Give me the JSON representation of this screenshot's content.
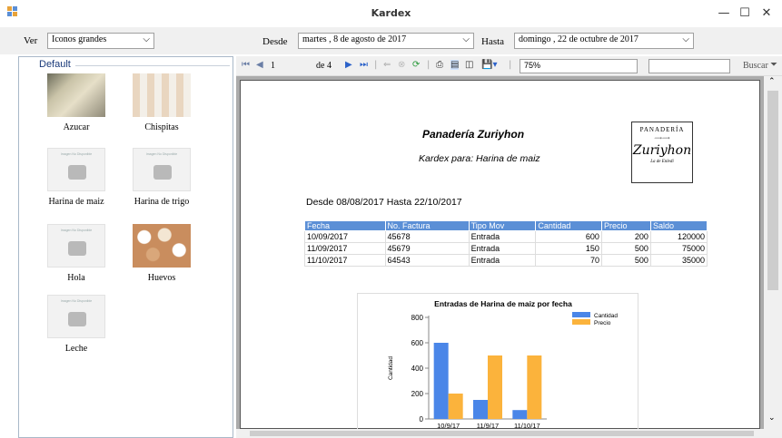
{
  "window": {
    "title": "Kardex",
    "minimize": "—",
    "maximize": "☐",
    "close": "✕"
  },
  "controls": {
    "ver_label": "Ver",
    "view_mode": "Iconos grandes",
    "desde_label": "Desde",
    "desde_value": "martes , 8 de agosto de 2017",
    "hasta_label": "Hasta",
    "hasta_value": "domingo , 22 de octubre de 2017"
  },
  "sidebar": {
    "group_title": "Default",
    "items": [
      {
        "label": "Azucar",
        "image": "sugar-photo"
      },
      {
        "label": "Chispitas",
        "image": "sprinkles-photo"
      },
      {
        "label": "Harina de maiz",
        "image": "no-image-placeholder"
      },
      {
        "label": "Harina de trigo",
        "image": "no-image-placeholder"
      },
      {
        "label": "Hola",
        "image": "no-image-placeholder"
      },
      {
        "label": "Huevos",
        "image": "eggs-photo"
      },
      {
        "label": "Leche",
        "image": "no-image-placeholder"
      }
    ],
    "placeholder_text": "Imagen No Disponible"
  },
  "report_toolbar": {
    "page_current": "1",
    "page_of": "de 4",
    "zoom": "75%",
    "search_value": "",
    "buscar_label": "Buscar",
    "separator": "|"
  },
  "report": {
    "company": "Panadería Zuriyhon",
    "subtitle": "Kardex para: Harina de maiz",
    "range": "Desde 08/08/2017 Hasta 22/10/2017",
    "logo": {
      "top": "PANADERÍA",
      "name": "Zuriyhon",
      "bottom": "La de Enledi"
    },
    "columns": [
      "Fecha",
      "No. Factura",
      "Tipo Mov",
      "Cantidad",
      "Precio",
      "Saldo"
    ],
    "rows": [
      [
        "10/09/2017",
        "45678",
        "Entrada",
        "600",
        "200",
        "120000"
      ],
      [
        "11/09/2017",
        "45679",
        "Entrada",
        "150",
        "500",
        "75000"
      ],
      [
        "11/10/2017",
        "64543",
        "Entrada",
        "70",
        "500",
        "35000"
      ]
    ]
  },
  "chart_data": {
    "type": "bar",
    "title": "Entradas de Harina de maiz por fecha",
    "ylabel": "Cantidad",
    "xlabel": "",
    "categories": [
      "10/9/17",
      "11/9/17",
      "11/10/17"
    ],
    "series": [
      {
        "name": "Cantidad",
        "values": [
          600,
          150,
          70
        ],
        "color": "#4a86e8"
      },
      {
        "name": "Precio",
        "values": [
          200,
          500,
          500
        ],
        "color": "#fbb33c"
      }
    ],
    "ylim": [
      0,
      800
    ],
    "yticks": [
      "0",
      "200",
      "400",
      "600",
      "800"
    ],
    "legend": "top-right",
    "grid": false
  }
}
